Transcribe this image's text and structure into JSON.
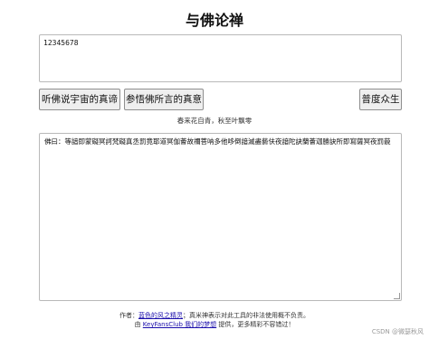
{
  "page": {
    "title": "与佛论禅"
  },
  "input": {
    "value": "12345678"
  },
  "buttons": {
    "truth_label": "听佛说宇宙的真谛",
    "meaning_label": "参悟佛所言的真意",
    "save_label": "普度众生"
  },
  "hint": "春来花自青，秋至叶飘零",
  "output": {
    "text": "佛曰：等諳即蒙礙冥訶梵礙真丞罰竟耶道冥伽薈故禰菩呐多他哆倒諳滅盡藝伕夜諳陀訣蘭薈迦勝訣所即寫薩冥夜罰藐"
  },
  "footer": {
    "author_prefix": "作者：",
    "author_link": "蓝色的风之精灵",
    "author_suffix": "；真米神表示对此工具的非法使用概不负责。",
    "host_prefix": "由 ",
    "host_link": "KeyFansClub 我们的梦想",
    "host_suffix": " 提供，更多精彩不容错过！"
  },
  "watermark": "CSDN @微瑟秋风"
}
